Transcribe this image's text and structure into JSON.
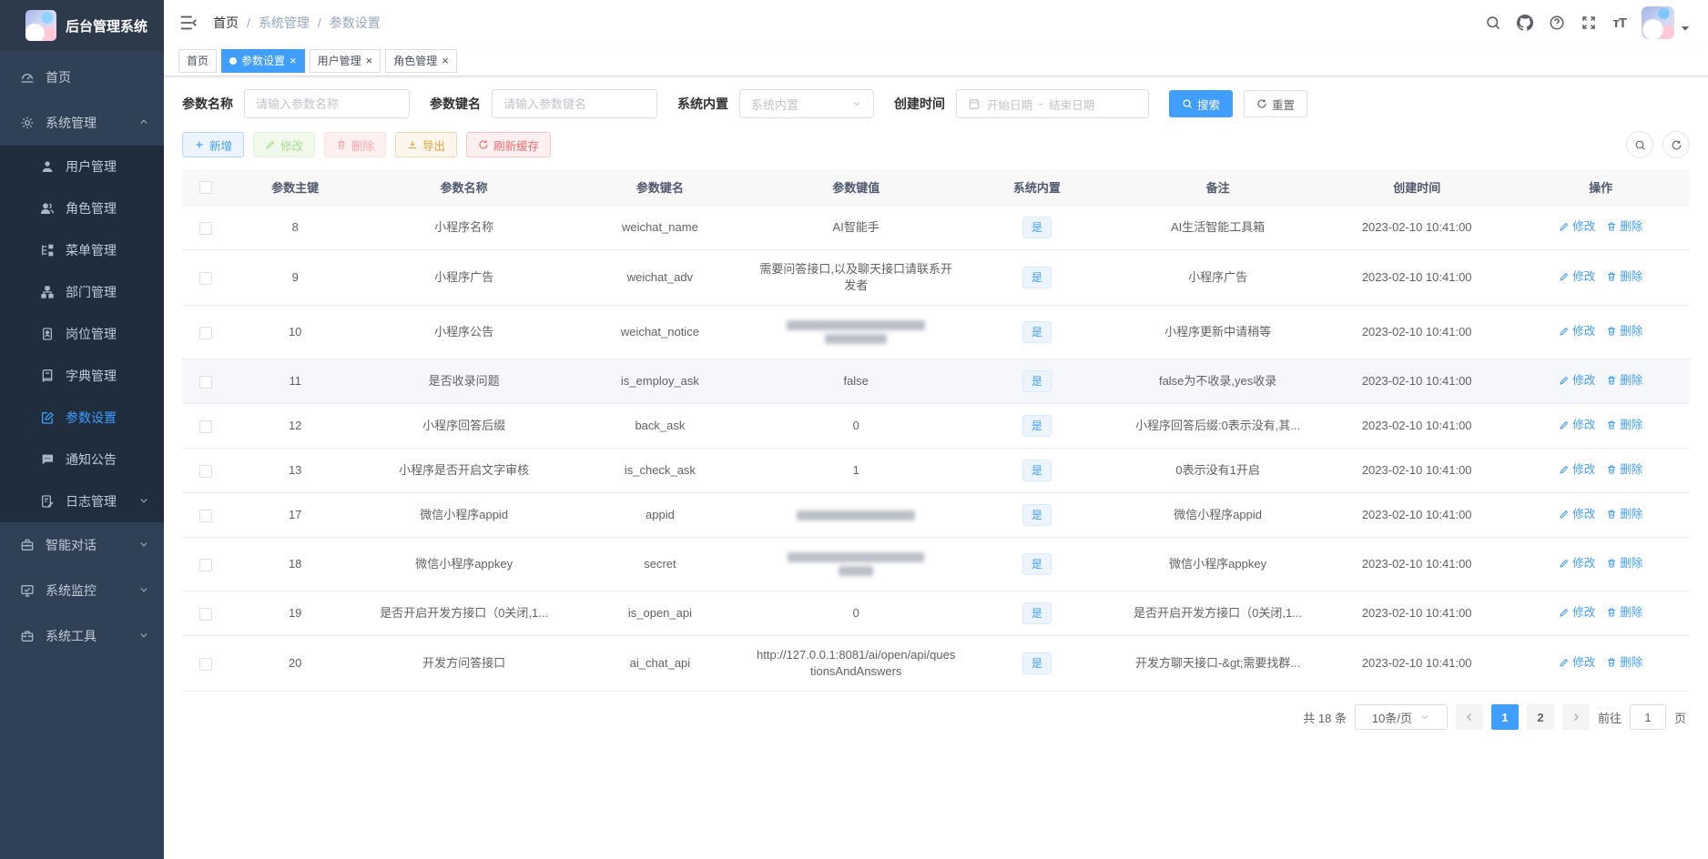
{
  "app": {
    "title": "后台管理系统"
  },
  "sidebar": {
    "items": [
      {
        "label": "首页",
        "icon": "dashboard",
        "type": "item"
      },
      {
        "label": "系统管理",
        "icon": "gear",
        "type": "group",
        "expanded": true,
        "children": [
          {
            "label": "用户管理",
            "icon": "user"
          },
          {
            "label": "角色管理",
            "icon": "users"
          },
          {
            "label": "菜单管理",
            "icon": "menu-tree"
          },
          {
            "label": "部门管理",
            "icon": "org-chart"
          },
          {
            "label": "岗位管理",
            "icon": "id-badge"
          },
          {
            "label": "字典管理",
            "icon": "dictionary"
          },
          {
            "label": "参数设置",
            "icon": "edit",
            "active": true
          },
          {
            "label": "通知公告",
            "icon": "message"
          },
          {
            "label": "日志管理",
            "icon": "log",
            "collapsible": true
          }
        ]
      },
      {
        "label": "智能对话",
        "icon": "chat-tool",
        "type": "group",
        "expanded": false
      },
      {
        "label": "系统监控",
        "icon": "monitor",
        "type": "group",
        "expanded": false
      },
      {
        "label": "系统工具",
        "icon": "toolbox",
        "type": "group",
        "expanded": false
      }
    ]
  },
  "breadcrumb": {
    "items": [
      "首页",
      "系统管理",
      "参数设置"
    ]
  },
  "tabs": [
    {
      "label": "首页"
    },
    {
      "label": "参数设置"
    },
    {
      "label": "用户管理"
    },
    {
      "label": "角色管理"
    }
  ],
  "filters": {
    "name_label": "参数名称",
    "name_placeholder": "请输入参数名称",
    "key_label": "参数键名",
    "key_placeholder": "请输入参数键名",
    "builtin_label": "系统内置",
    "builtin_placeholder": "系统内置",
    "time_label": "创建时间",
    "date_start_placeholder": "开始日期",
    "date_separator": "-",
    "date_end_placeholder": "结束日期",
    "search_label": "搜索",
    "reset_label": "重置"
  },
  "toolbar": {
    "add_label": "新增",
    "edit_label": "修改",
    "delete_label": "删除",
    "export_label": "导出",
    "refresh_cache_label": "刷新缓存"
  },
  "table": {
    "columns": [
      "参数主键",
      "参数名称",
      "参数键名",
      "参数键值",
      "系统内置",
      "备注",
      "创建时间",
      "操作"
    ],
    "builtin_tag": "是",
    "op_edit_label": "修改",
    "op_delete_label": "删除",
    "rows": [
      {
        "id": "8",
        "name": "小程序名称",
        "key": "weichat_name",
        "value": "AI智能手",
        "builtin": "是",
        "remark": "AI生活智能工具箱",
        "time": "2023-02-10 10:41:00"
      },
      {
        "id": "9",
        "name": "小程序广告",
        "key": "weichat_adv",
        "value": "需要问答接口,以及聊天接口请联系开发者",
        "builtin": "是",
        "remark": "小程序广告",
        "time": "2023-02-10 10:41:00"
      },
      {
        "id": "10",
        "name": "小程序公告",
        "key": "weichat_notice",
        "value": "",
        "value_blurred": true,
        "value_mask_widths": [
          152,
          68
        ],
        "builtin": "是",
        "remark": "小程序更新中请稍等",
        "time": "2023-02-10 10:41:00"
      },
      {
        "id": "11",
        "name": "是否收录问题",
        "key": "is_employ_ask",
        "value": "false",
        "builtin": "是",
        "remark": "false为不收录,yes收录",
        "time": "2023-02-10 10:41:00",
        "highlighted": true
      },
      {
        "id": "12",
        "name": "小程序回答后缀",
        "key": "back_ask",
        "value": "0",
        "builtin": "是",
        "remark": "小程序回答后缀:0表示没有,其...",
        "time": "2023-02-10 10:41:00"
      },
      {
        "id": "13",
        "name": "小程序是否开启文字审核",
        "key": "is_check_ask",
        "value": "1",
        "builtin": "是",
        "remark": "0表示没有1开启",
        "time": "2023-02-10 10:41:00"
      },
      {
        "id": "17",
        "name": "微信小程序appid",
        "key": "appid",
        "value": "",
        "value_blurred": true,
        "value_mask_widths": [
          130
        ],
        "builtin": "是",
        "remark": "微信小程序appid",
        "time": "2023-02-10 10:41:00"
      },
      {
        "id": "18",
        "name": "微信小程序appkey",
        "key": "secret",
        "value": "",
        "value_blurred": true,
        "value_mask_widths": [
          150,
          38
        ],
        "builtin": "是",
        "remark": "微信小程序appkey",
        "time": "2023-02-10 10:41:00"
      },
      {
        "id": "19",
        "name": "是否开启开发方接口（0关闭,1...",
        "key": "is_open_api",
        "value": "0",
        "builtin": "是",
        "remark": "是否开启开发方接口（0关闭,1...",
        "time": "2023-02-10 10:41:00"
      },
      {
        "id": "20",
        "name": "开发方问答接口",
        "key": "ai_chat_api",
        "value": "http://127.0.0.1:8081/ai/open/api/questionsAndAnswers",
        "builtin": "是",
        "remark": "开发方聊天接口-&gt;需要找群...",
        "time": "2023-02-10 10:41:00"
      }
    ]
  },
  "pagination": {
    "total_label": "共 18 条",
    "page_size_label": "10条/页",
    "pages": [
      "1",
      "2"
    ],
    "current_page": "1",
    "goto_label": "前往",
    "goto_value": "1",
    "goto_unit": "页"
  },
  "colors": {
    "accent": "#409eff",
    "sidebar_bg": "#304156",
    "submenu_bg": "#1f2d3d",
    "tag_bg": "#ecf5ff"
  }
}
